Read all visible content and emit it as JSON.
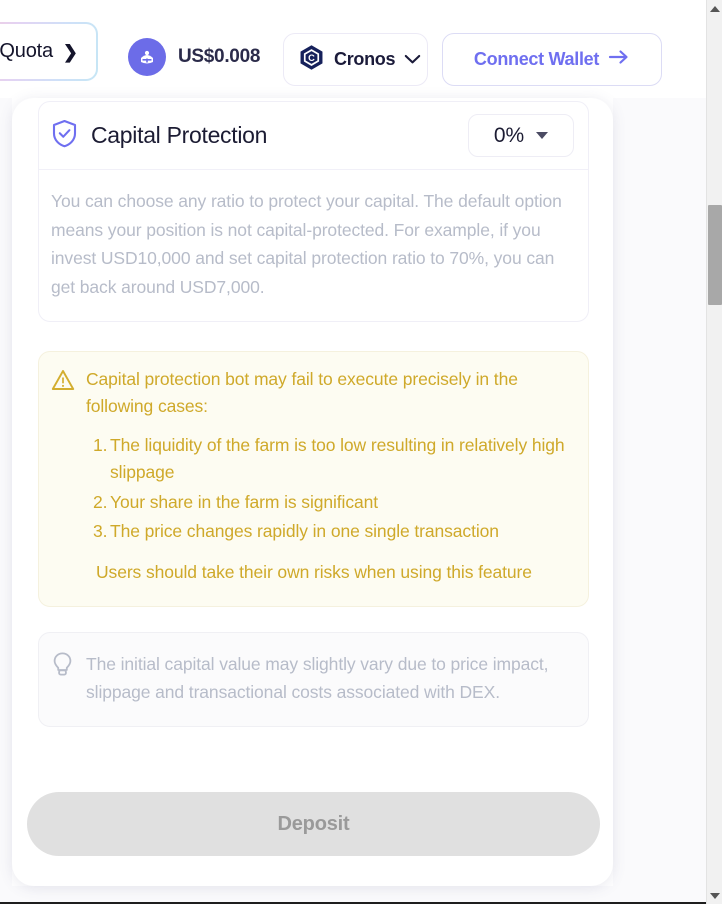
{
  "header": {
    "quota": {
      "label": "Quota",
      "arrow_icon": "chevron-right-icon"
    },
    "price": {
      "token_icon": "token-avatar-icon",
      "value": "US$0.008"
    },
    "chain": {
      "icon": "cronos-logo-icon",
      "name": "Cronos",
      "chevron": "chevron-down-icon"
    },
    "connect_wallet": {
      "label": "Connect Wallet",
      "arrow_icon": "arrow-right-icon"
    }
  },
  "capital_protection": {
    "icon": "shield-check-icon",
    "title": "Capital Protection",
    "ratio": {
      "value": "0%",
      "chevron": "chevron-down-icon"
    },
    "description": "You can choose any ratio to protect your capital. The default option means your position is not capital-protected. For example, if you invest USD10,000 and set capital protection ratio to 70%, you can get back around USD7,000."
  },
  "warning": {
    "icon": "warning-triangle-icon",
    "heading": "Capital protection bot may fail to execute precisely in the following cases:",
    "items": [
      {
        "num": "1.",
        "text": "The liquidity of the farm is too low resulting in relatively high slippage"
      },
      {
        "num": "2.",
        "text": "Your share in the farm is significant"
      },
      {
        "num": "3.",
        "text": "The price changes rapidly in one single transaction"
      }
    ],
    "footer": "Users should take their own risks when using this feature",
    "color": "#cfa92a",
    "background": "#fdfcf2"
  },
  "tip": {
    "icon": "lightbulb-icon",
    "text": "The initial capital value may slightly vary due to price impact, slippage and transactional costs associated with DEX."
  },
  "actions": {
    "deposit_label": "Deposit",
    "deposit_disabled": true
  },
  "scrollbar": {
    "up_icon": "scroll-up-arrow-icon",
    "down_icon": "scroll-down-arrow-icon",
    "thumb": "scrollbar-thumb"
  },
  "colors": {
    "accent": "#6f6ff0",
    "warning": "#cfa92a",
    "muted_text": "#b7bcc9",
    "heading": "#1c1c33"
  }
}
